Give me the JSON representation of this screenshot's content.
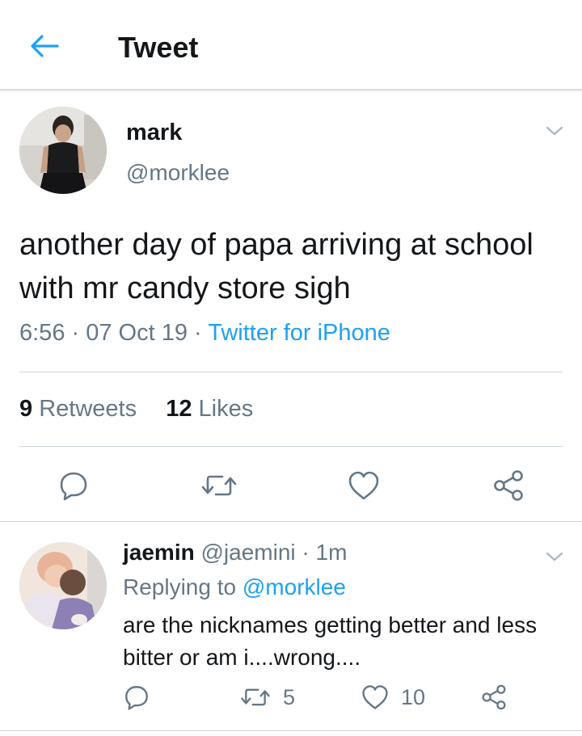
{
  "header": {
    "title": "Tweet",
    "back_icon": "arrow-left-icon"
  },
  "colors": {
    "accent": "#1da1f2",
    "secondary_text": "#657786",
    "primary_text": "#14171a",
    "divider": "#ccd6dd"
  },
  "tweet": {
    "display_name": "mark",
    "handle": "@morklee",
    "text": "another day of papa arriving at school with mr candy store sigh",
    "time": "6:56",
    "date": "07 Oct 19",
    "source": "Twitter for iPhone",
    "retweets_count": "9",
    "retweets_label": "Retweets",
    "likes_count": "12",
    "likes_label": "Likes",
    "actions": [
      "reply-icon",
      "retweet-icon",
      "like-icon",
      "share-icon"
    ]
  },
  "reply": {
    "display_name": "jaemin",
    "handle": "@jaemini",
    "time": "1m",
    "replying_label": "Replying to",
    "replying_to": "@morklee",
    "text": "are the nicknames getting better and less bitter or am i....wrong....",
    "retweet_count": "5",
    "like_count": "10"
  }
}
